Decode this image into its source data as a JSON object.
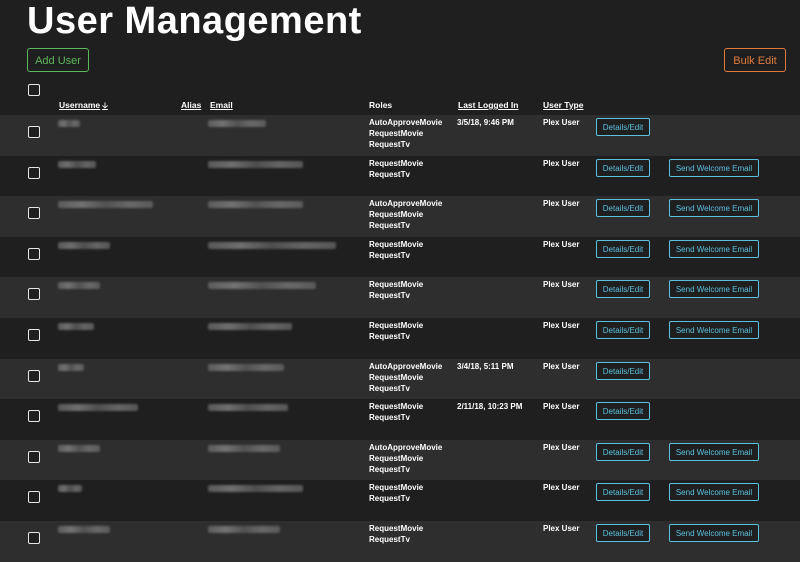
{
  "page": {
    "title": "User Management"
  },
  "toolbar": {
    "add_user_label": "Add User",
    "bulk_edit_label": "Bulk Edit"
  },
  "table": {
    "headers": {
      "username": "Username",
      "alias": "Alias",
      "email": "Email",
      "roles": "Roles",
      "last_logged_in": "Last Logged In",
      "user_type": "User Type"
    },
    "sort_icon": "arrow-down-icon",
    "details_label": "Details/Edit",
    "welcome_label": "Send Welcome Email",
    "rows": [
      {
        "roles": [
          "AutoApproveMovie",
          "RequestMovie",
          "RequestTv"
        ],
        "last_logged_in": "3/5/18, 9:46 PM",
        "user_type": "Plex User",
        "welcome": false,
        "shade": true
      },
      {
        "roles": [
          "RequestMovie",
          "RequestTv"
        ],
        "last_logged_in": "",
        "user_type": "Plex User",
        "welcome": true,
        "shade": false
      },
      {
        "roles": [
          "AutoApproveMovie",
          "RequestMovie",
          "RequestTv"
        ],
        "last_logged_in": "",
        "user_type": "Plex User",
        "welcome": true,
        "shade": true
      },
      {
        "roles": [
          "RequestMovie",
          "RequestTv"
        ],
        "last_logged_in": "",
        "user_type": "Plex User",
        "welcome": true,
        "shade": false
      },
      {
        "roles": [
          "RequestMovie",
          "RequestTv"
        ],
        "last_logged_in": "",
        "user_type": "Plex User",
        "welcome": true,
        "shade": true
      },
      {
        "roles": [
          "RequestMovie",
          "RequestTv"
        ],
        "last_logged_in": "",
        "user_type": "Plex User",
        "welcome": true,
        "shade": false
      },
      {
        "roles": [
          "AutoApproveMovie",
          "RequestMovie",
          "RequestTv"
        ],
        "last_logged_in": "3/4/18, 5:11 PM",
        "user_type": "Plex User",
        "welcome": false,
        "shade": true
      },
      {
        "roles": [
          "RequestMovie",
          "RequestTv"
        ],
        "last_logged_in": "2/11/18, 10:23 PM",
        "user_type": "Plex User",
        "welcome": false,
        "shade": false
      },
      {
        "roles": [
          "AutoApproveMovie",
          "RequestMovie",
          "RequestTv"
        ],
        "last_logged_in": "",
        "user_type": "Plex User",
        "welcome": true,
        "shade": true
      },
      {
        "roles": [
          "RequestMovie",
          "RequestTv"
        ],
        "last_logged_in": "",
        "user_type": "Plex User",
        "welcome": true,
        "shade": false
      },
      {
        "roles": [
          "RequestMovie",
          "RequestTv"
        ],
        "last_logged_in": "",
        "user_type": "Plex User",
        "welcome": true,
        "shade": true
      }
    ]
  }
}
